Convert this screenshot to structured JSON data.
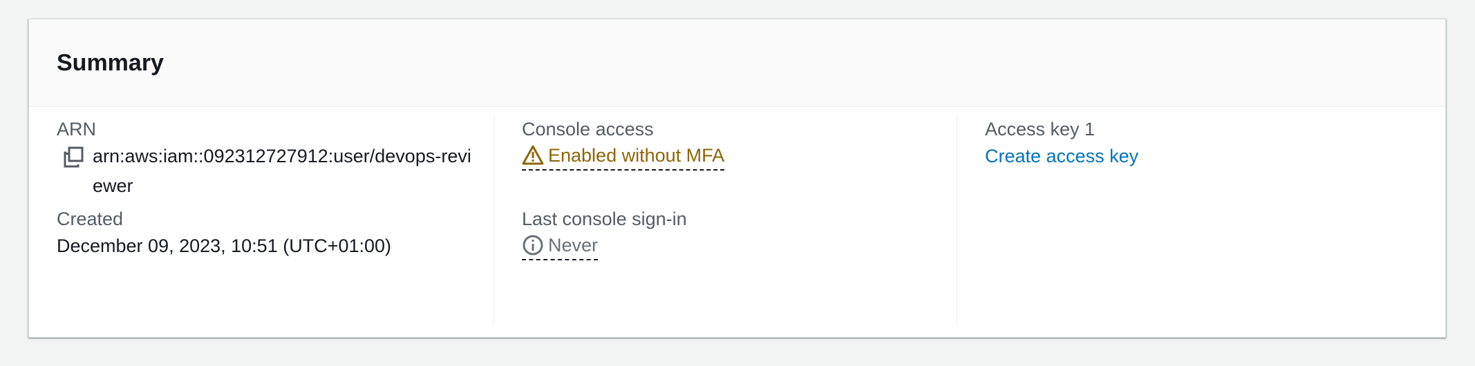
{
  "summary": {
    "title": "Summary",
    "arn": {
      "label": "ARN",
      "value": "arn:aws:iam::092312727912:user/devops-reviewer",
      "icon": "copy-icon"
    },
    "created": {
      "label": "Created",
      "value": "December 09, 2023, 10:51 (UTC+01:00)"
    },
    "console_access": {
      "label": "Console access",
      "value": "Enabled without MFA",
      "icon": "warning-icon",
      "color": "#8d6605"
    },
    "last_sign_in": {
      "label": "Last console sign-in",
      "value": "Never",
      "icon": "info-icon",
      "color": "#687078"
    },
    "access_key": {
      "label": "Access key 1",
      "link": "Create access key",
      "color": "#0073bb"
    }
  }
}
